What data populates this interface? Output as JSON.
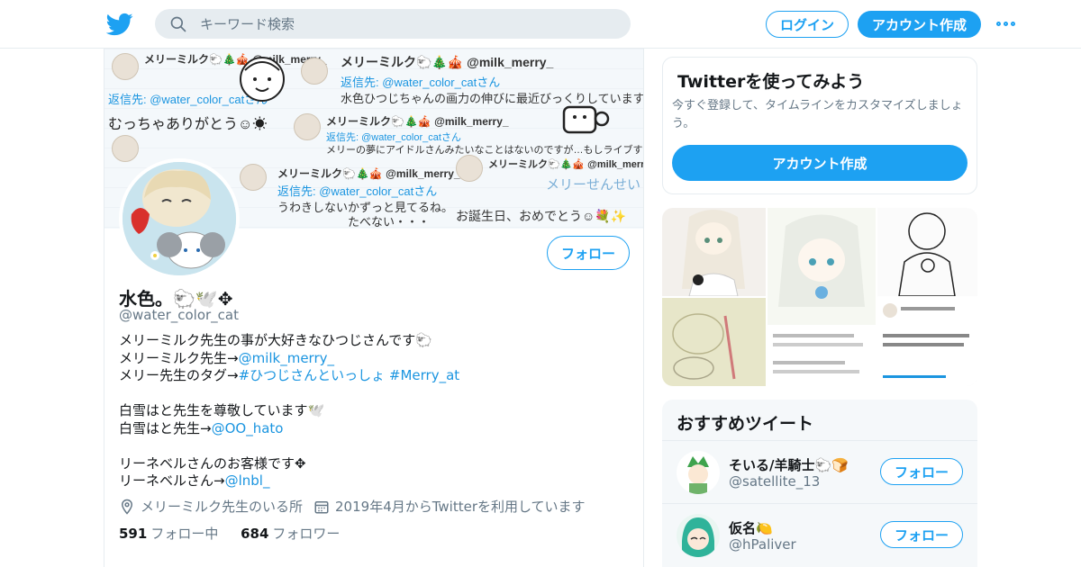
{
  "header": {
    "search_placeholder": "キーワード検索",
    "login_label": "ログイン",
    "signup_label": "アカウント作成"
  },
  "banner": {
    "texts": [
      "メリーミルク🐑🎄🎪 @milk_merry_",
      "返信先: @water_color_catさん",
      "むっちゃありがとう☺☀",
      "水色ひつじちゃんの画力の伸びに最近びっくりしています…",
      "メリーの夢にアイドルさんみたいなことはないのですが…もしライブする",
      "うわきしないかずっと見てるね。",
      "たべない・・・",
      "お誕生日、おめでとう☺💐✨",
      "メリーせんせい だいすき"
    ]
  },
  "profile": {
    "name": "水色。🐑🕊️✥",
    "handle": "@water_color_cat",
    "follow_label": "フォロー",
    "bio": [
      {
        "text": "メリーミルク先生の事が大好きなひつじさんです🐑",
        "link": ""
      },
      {
        "text": "メリーミルク先生→",
        "link": "@milk_merry_"
      },
      {
        "text": "メリー先生のタグ→",
        "link": "#ひつじさんといっしょ #Merry_at"
      },
      {
        "text": "",
        "link": ""
      },
      {
        "text": "白雪はと先生を尊敬しています🕊️",
        "link": ""
      },
      {
        "text": "白雪はと先生→",
        "link": "@OO_hato"
      },
      {
        "text": "",
        "link": ""
      },
      {
        "text": "リーネベルさんのお客様です✥",
        "link": ""
      },
      {
        "text": "リーネベルさん→",
        "link": "@lnbl_"
      }
    ],
    "location": "メリーミルク先生のいる所",
    "joined": "2019年4月からTwitterを利用しています",
    "following_count": "591",
    "following_label": "フォロー中",
    "followers_count": "684",
    "followers_label": "フォロワー"
  },
  "signup_card": {
    "title": "Twitterを使ってみよう",
    "desc": "今すぐ登録して、タイムラインをカスタマイズしましょう。",
    "button": "アカウント作成"
  },
  "recommend": {
    "title": "おすすめツイート",
    "items": [
      {
        "name": "そいる/羊騎士🐑🍞",
        "handle": "@satellite_13",
        "follow_label": "フォロー"
      },
      {
        "name": "仮名🍋",
        "handle": "@hPaliver",
        "follow_label": "フォロー"
      }
    ]
  },
  "colors": {
    "brand": "#1da1f2",
    "link": "#1b95e0",
    "muted": "#657786"
  }
}
